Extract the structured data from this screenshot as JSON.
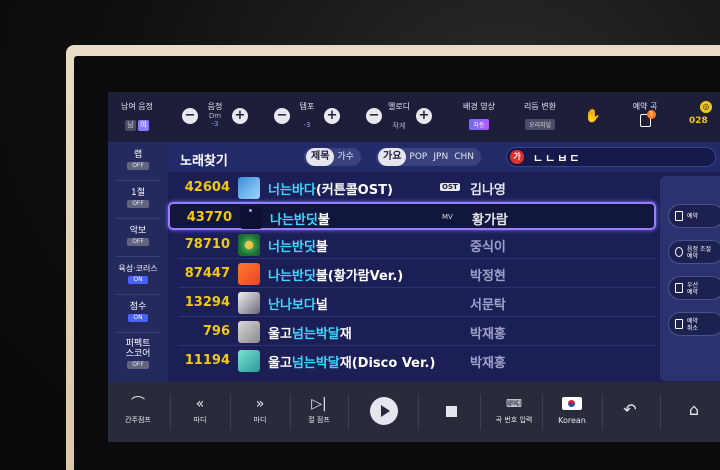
{
  "topbar": {
    "key_gender": {
      "label": "남여 음정",
      "male": "남",
      "female": "여"
    },
    "pitch": {
      "label": "음정",
      "key": "Dm",
      "value": "-3"
    },
    "tempo": {
      "label": "템포",
      "value": "-3"
    },
    "melody": {
      "label": "멜로디",
      "value": "작게"
    },
    "bg_video": {
      "label": "배경 영상",
      "value": "자동"
    },
    "rhythm": {
      "label": "리듬 변환",
      "value": "오리지널"
    },
    "reserve": {
      "label": "예약 곡",
      "count": "3"
    },
    "coin": {
      "value": "028"
    }
  },
  "sidebar": {
    "items": [
      {
        "label": "랩",
        "state": "OFF"
      },
      {
        "label": "1절",
        "state": "OFF"
      },
      {
        "label": "악보",
        "state": "OFF"
      },
      {
        "label": "육성·코러스",
        "state": "ON"
      },
      {
        "label": "점수",
        "state": "ON"
      },
      {
        "label": "퍼펙트\n스코어",
        "line1": "퍼펙트",
        "line2": "스코어",
        "state": "OFF"
      }
    ]
  },
  "search": {
    "title": "노래찾기",
    "field_active": "제목",
    "field_other": "가수",
    "genre_active": "가요",
    "genre_pop": "POP",
    "genre_jpn": "JPN",
    "genre_chn": "CHN",
    "lang_icon": "가",
    "query": "ㄴㄴㅂㄷ"
  },
  "songs": [
    {
      "num": "42604",
      "pre": "",
      "hl": "너는바다",
      "post": "(커튼콜OST)",
      "tag": "OST",
      "artist": "김나영"
    },
    {
      "num": "43770",
      "pre": "",
      "hl": "나는반딧",
      "post": "불",
      "tag": "MV",
      "artist": "황가람",
      "selected": true
    },
    {
      "num": "78710",
      "pre": "",
      "hl": "너는반딧",
      "post": "불",
      "tag": "",
      "artist": "중식이"
    },
    {
      "num": "87447",
      "pre": "",
      "hl": "나는반딧",
      "post": "불(황가람Ver.)",
      "tag": "",
      "artist": "박정현"
    },
    {
      "num": "13294",
      "pre": "",
      "hl": "난나보다",
      "post": "널",
      "tag": "",
      "artist": "서문탁"
    },
    {
      "num": "796",
      "pre": "울고",
      "hl": "넘는박달",
      "post": "재",
      "tag": "",
      "artist": "박재홍"
    },
    {
      "num": "11194",
      "pre": "울고",
      "hl": "넘는박달",
      "post": "재(Disco Ver.)",
      "tag": "",
      "artist": "박재홍"
    }
  ],
  "right_panel": {
    "reserve": "예약",
    "pitch_reserve_1": "음정 조절",
    "pitch_reserve_2": "예약",
    "priority_1": "우선",
    "priority_2": "예약",
    "cancel_1": "예약",
    "cancel_2": "취소"
  },
  "bottombar": {
    "interlude_jump": "간주점프",
    "bar_back": "마디",
    "bar_forward": "마디",
    "verse_jump": "절 점프",
    "number_input": "곡 번호 입력",
    "language": "Korean"
  }
}
